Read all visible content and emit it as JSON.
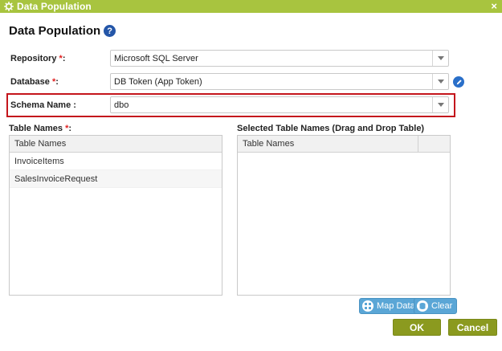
{
  "window": {
    "title": "Data Population",
    "close_glyph": "×"
  },
  "heading": {
    "title": "Data Population",
    "help_glyph": "?"
  },
  "form": {
    "repository": {
      "label": "Repository",
      "required_mark": "*",
      "suffix": ":",
      "value": "Microsoft SQL Server"
    },
    "database": {
      "label": "Database",
      "required_mark": "*",
      "suffix": ":",
      "value": "DB Token (App Token)"
    },
    "schema": {
      "label": "Schema Name :",
      "value": "dbo"
    }
  },
  "table_names": {
    "label": "Table Names",
    "required_mark": "*",
    "suffix": ":",
    "column_header": "Table Names",
    "rows": [
      "InvoiceItems",
      "SalesInvoiceRequest"
    ]
  },
  "selected_tables": {
    "label": "Selected Table Names (Drag and Drop Table)",
    "column_header": "Table Names",
    "rows": []
  },
  "buttons": {
    "map_data": "Map Data",
    "clear": "Clear",
    "ok": "OK",
    "cancel": "Cancel"
  },
  "colors": {
    "title_bar": "#a8c43f",
    "primary_button": "#8b9a1f",
    "tool_button": "#5aa6d6",
    "highlight": "#c4151c",
    "required": "#e02020",
    "help_icon": "#2456a8"
  },
  "icons": {
    "title": "gear-icon",
    "help": "help-icon",
    "edit": "pencil-icon",
    "map_data": "map-data-icon",
    "clear": "clear-icon",
    "dropdown": "chevron-down-icon",
    "close": "close-icon"
  }
}
